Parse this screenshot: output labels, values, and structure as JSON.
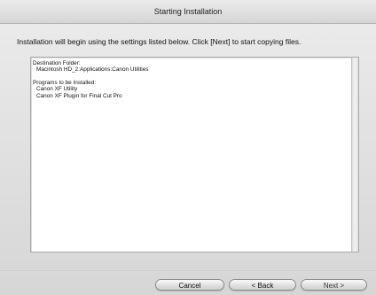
{
  "window": {
    "title": "Starting Installation"
  },
  "instruction": "Installation will begin using the settings listed below. Click [Next] to start copying files.",
  "summary": {
    "destination_label": "Destination Folder:",
    "destination_value": "Macintosh HD_2:Applications:Canon Utilities",
    "programs_label": "Programs to be Installed:",
    "programs": [
      "Canon XF Utility",
      "Canon XF Plugin for Final Cut Pro"
    ]
  },
  "buttons": {
    "cancel": "Cancel",
    "back": "< Back",
    "next": "Next >"
  }
}
